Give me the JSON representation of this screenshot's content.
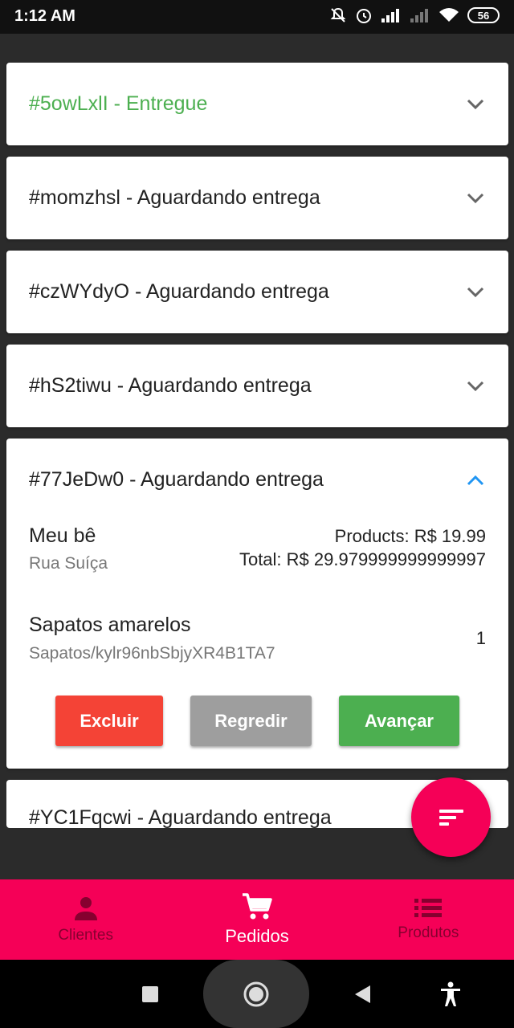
{
  "status_bar": {
    "time": "1:12 AM",
    "battery": "56"
  },
  "orders": [
    {
      "title": "#5owLxlI - Entregue",
      "delivered": true,
      "expanded": false
    },
    {
      "title": "#momzhsl - Aguardando entrega",
      "delivered": false,
      "expanded": false
    },
    {
      "title": "#czWYdyO - Aguardando entrega",
      "delivered": false,
      "expanded": false
    },
    {
      "title": "#hS2tiwu - Aguardando entrega",
      "delivered": false,
      "expanded": false
    },
    {
      "title": "#77JeDw0 - Aguardando entrega",
      "delivered": false,
      "expanded": true
    }
  ],
  "expanded_order": {
    "customer_name": "Meu bê",
    "customer_address": "Rua Suíça",
    "products_total": "Products: R$ 19.99",
    "grand_total": "Total: R$ 29.979999999999997",
    "item": {
      "name": "Sapatos amarelos",
      "sku": "Sapatos/kylr96nbSbjyXR4B1TA7",
      "quantity": "1"
    },
    "buttons": {
      "delete": "Excluir",
      "back": "Regredir",
      "next": "Avançar"
    }
  },
  "partial_order": {
    "title": "#YC1Fqcwi - Aguardando entrega"
  },
  "colors": {
    "accent": "#f50057",
    "delivered": "#4caf50",
    "delete": "#f44336",
    "back": "#9e9e9e",
    "expand": "#2196f3"
  },
  "bottom_nav": [
    {
      "label": "Clientes",
      "icon": "person-icon",
      "active": false
    },
    {
      "label": "Pedidos",
      "icon": "cart-icon",
      "active": true
    },
    {
      "label": "Produtos",
      "icon": "list-icon",
      "active": false
    }
  ]
}
